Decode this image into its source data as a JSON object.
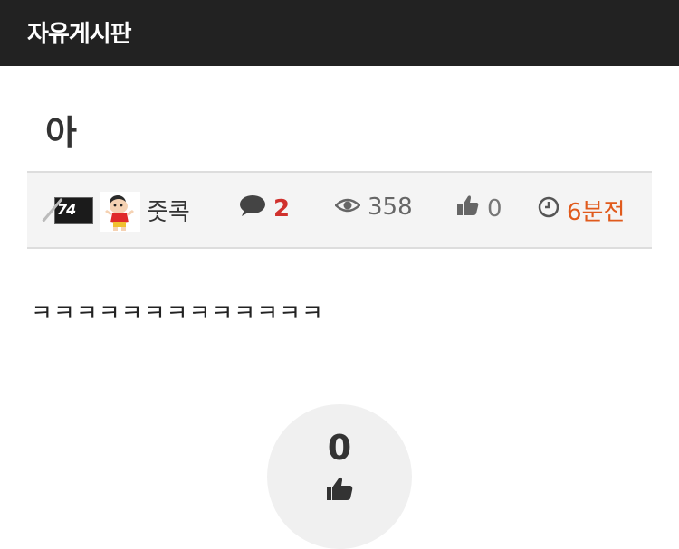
{
  "header": {
    "board_title": "자유게시판"
  },
  "post": {
    "title": "아",
    "content": "ㅋㅋㅋㅋㅋㅋㅋㅋㅋㅋㅋㅋㅋ"
  },
  "meta": {
    "level_badge_text": "74",
    "author": "줏콕",
    "comment_count": "2",
    "view_count": "358",
    "like_count": "0",
    "time_ago": "6분전"
  },
  "vote": {
    "count": "0"
  },
  "icons": {
    "comment": "comment-icon",
    "views": "eye-icon",
    "likes": "thumbs-up-icon",
    "time": "clock-icon"
  },
  "colors": {
    "header_bg": "#222222",
    "comment_count": "#d0312d",
    "time_ago": "#e05a1c",
    "meta_bg": "#f4f4f4"
  }
}
